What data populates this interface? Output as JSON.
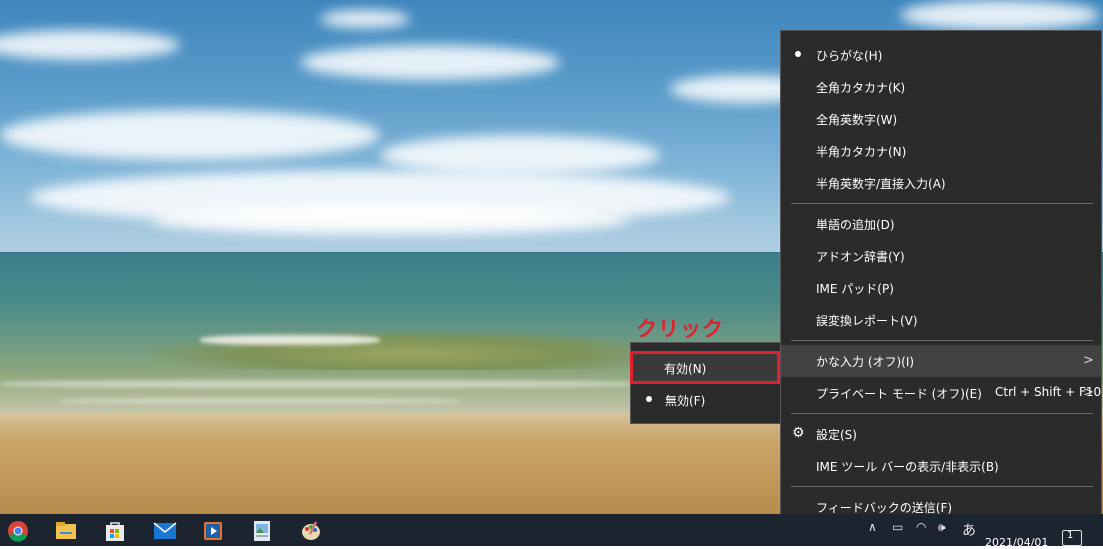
{
  "annotation": {
    "label": "クリック",
    "color": "#e0202e"
  },
  "ime_menu": {
    "items": [
      {
        "label": "ひらがな(H)",
        "selected": true
      },
      {
        "label": "全角カタカナ(K)"
      },
      {
        "label": "全角英数字(W)"
      },
      {
        "label": "半角カタカナ(N)"
      },
      {
        "label": "半角英数字/直接入力(A)"
      },
      {
        "label": "単語の追加(D)"
      },
      {
        "label": "アドオン辞書(Y)"
      },
      {
        "label": "IME パッド(P)"
      },
      {
        "label": "誤変換レポート(V)"
      },
      {
        "label": "かな入力 (オフ)(I)",
        "has_submenu": true,
        "highlighted": true
      },
      {
        "label": "プライベート モード (オフ)(E)",
        "shortcut": "Ctrl + Shift + F10",
        "has_submenu": true
      },
      {
        "label": "設定(S)",
        "icon": "gear-icon"
      },
      {
        "label": "IME ツール バーの表示/非表示(B)"
      },
      {
        "label": "フィードバックの送信(F)"
      }
    ],
    "chevron": ">"
  },
  "kana_submenu": {
    "items": [
      {
        "label": "有効(N)",
        "highlighted": true
      },
      {
        "label": "無効(F)",
        "selected": true
      }
    ]
  },
  "taskbar": {
    "apps": [
      "chrome-icon",
      "file-explorer-icon",
      "store-icon",
      "mail-icon",
      "media-player-icon",
      "photos-icon",
      "paint-icon"
    ],
    "clock_date": "2021/04/01",
    "ime_indicator": "あ",
    "notification_count": "1",
    "background": "#1c2430"
  }
}
